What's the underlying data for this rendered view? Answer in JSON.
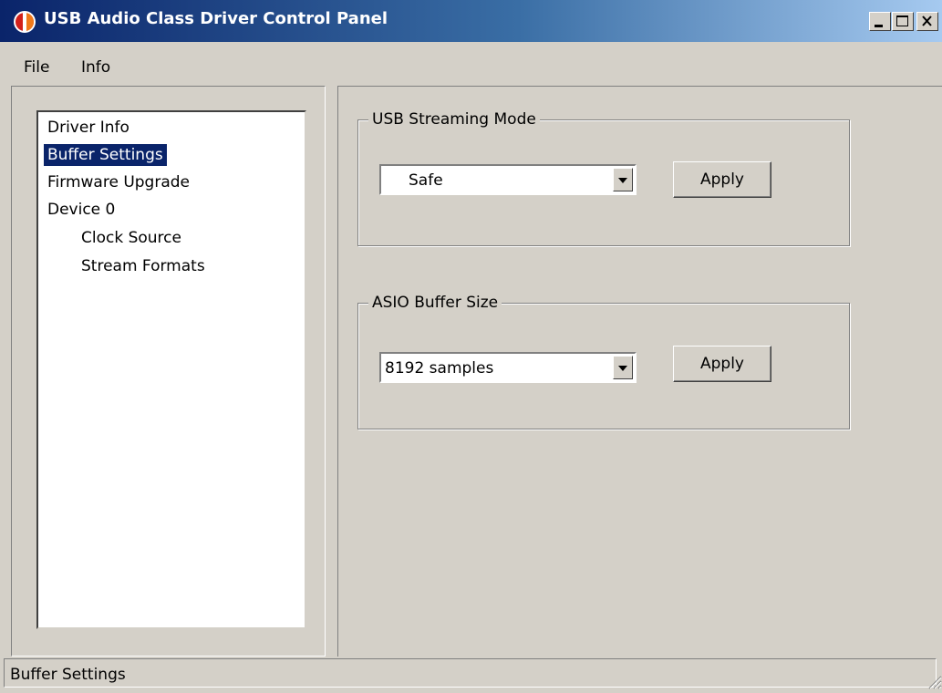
{
  "window": {
    "title": "USB Audio Class Driver Control Panel",
    "controls": [
      "minimize-icon",
      "maximize-icon",
      "close-icon"
    ]
  },
  "menu": {
    "file": "File",
    "info": "Info"
  },
  "tree": {
    "items": [
      {
        "label": "Driver Info",
        "selected": false
      },
      {
        "label": "Buffer Settings",
        "selected": true
      },
      {
        "label": "Firmware Upgrade",
        "selected": false
      },
      {
        "label": "Device 0",
        "selected": false
      },
      {
        "label": "Clock Source",
        "selected": false
      },
      {
        "label": "Stream Formats",
        "selected": false
      }
    ]
  },
  "streaming": {
    "group_label": "USB Streaming Mode",
    "selected_value": "Safe",
    "apply_label": "Apply"
  },
  "asio": {
    "group_label": "ASIO Buffer Size",
    "selected_value": "8192 samples",
    "apply_label": "Apply"
  },
  "status": {
    "text": "Buffer Settings"
  },
  "colors": {
    "title_bar_start": "#0a246a",
    "title_bar_end": "#a6caf0",
    "selection": "#0a246a",
    "face": "#d4d0c8"
  }
}
